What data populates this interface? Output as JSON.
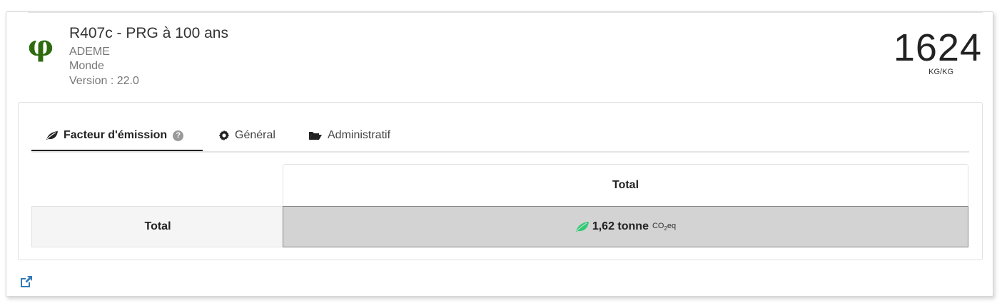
{
  "header": {
    "title": "R407c - PRG à 100 ans",
    "source": "ADEME",
    "region": "Monde",
    "version": "Version : 22.0",
    "value": "1624",
    "unit": "KG/KG",
    "logo_symbol": "φ"
  },
  "tabs": [
    {
      "label": "Facteur d'émission",
      "icon": "leaf-icon",
      "active": true
    },
    {
      "label": "Général",
      "icon": "gear-icon",
      "active": false
    },
    {
      "label": "Administratif",
      "icon": "folder-open-icon",
      "active": false
    }
  ],
  "table": {
    "column_header": "Total",
    "row_header": "Total",
    "value": "1,62 tonne",
    "unit_main": "CO",
    "unit_sub": "2",
    "unit_tail": "eq"
  },
  "colors": {
    "logo": "#2e6b0f",
    "leaf_green": "#2ecc71",
    "link_blue": "#337ab7",
    "cell_bg": "#d3d3d3"
  },
  "footer": {
    "icon": "external-link-icon"
  }
}
